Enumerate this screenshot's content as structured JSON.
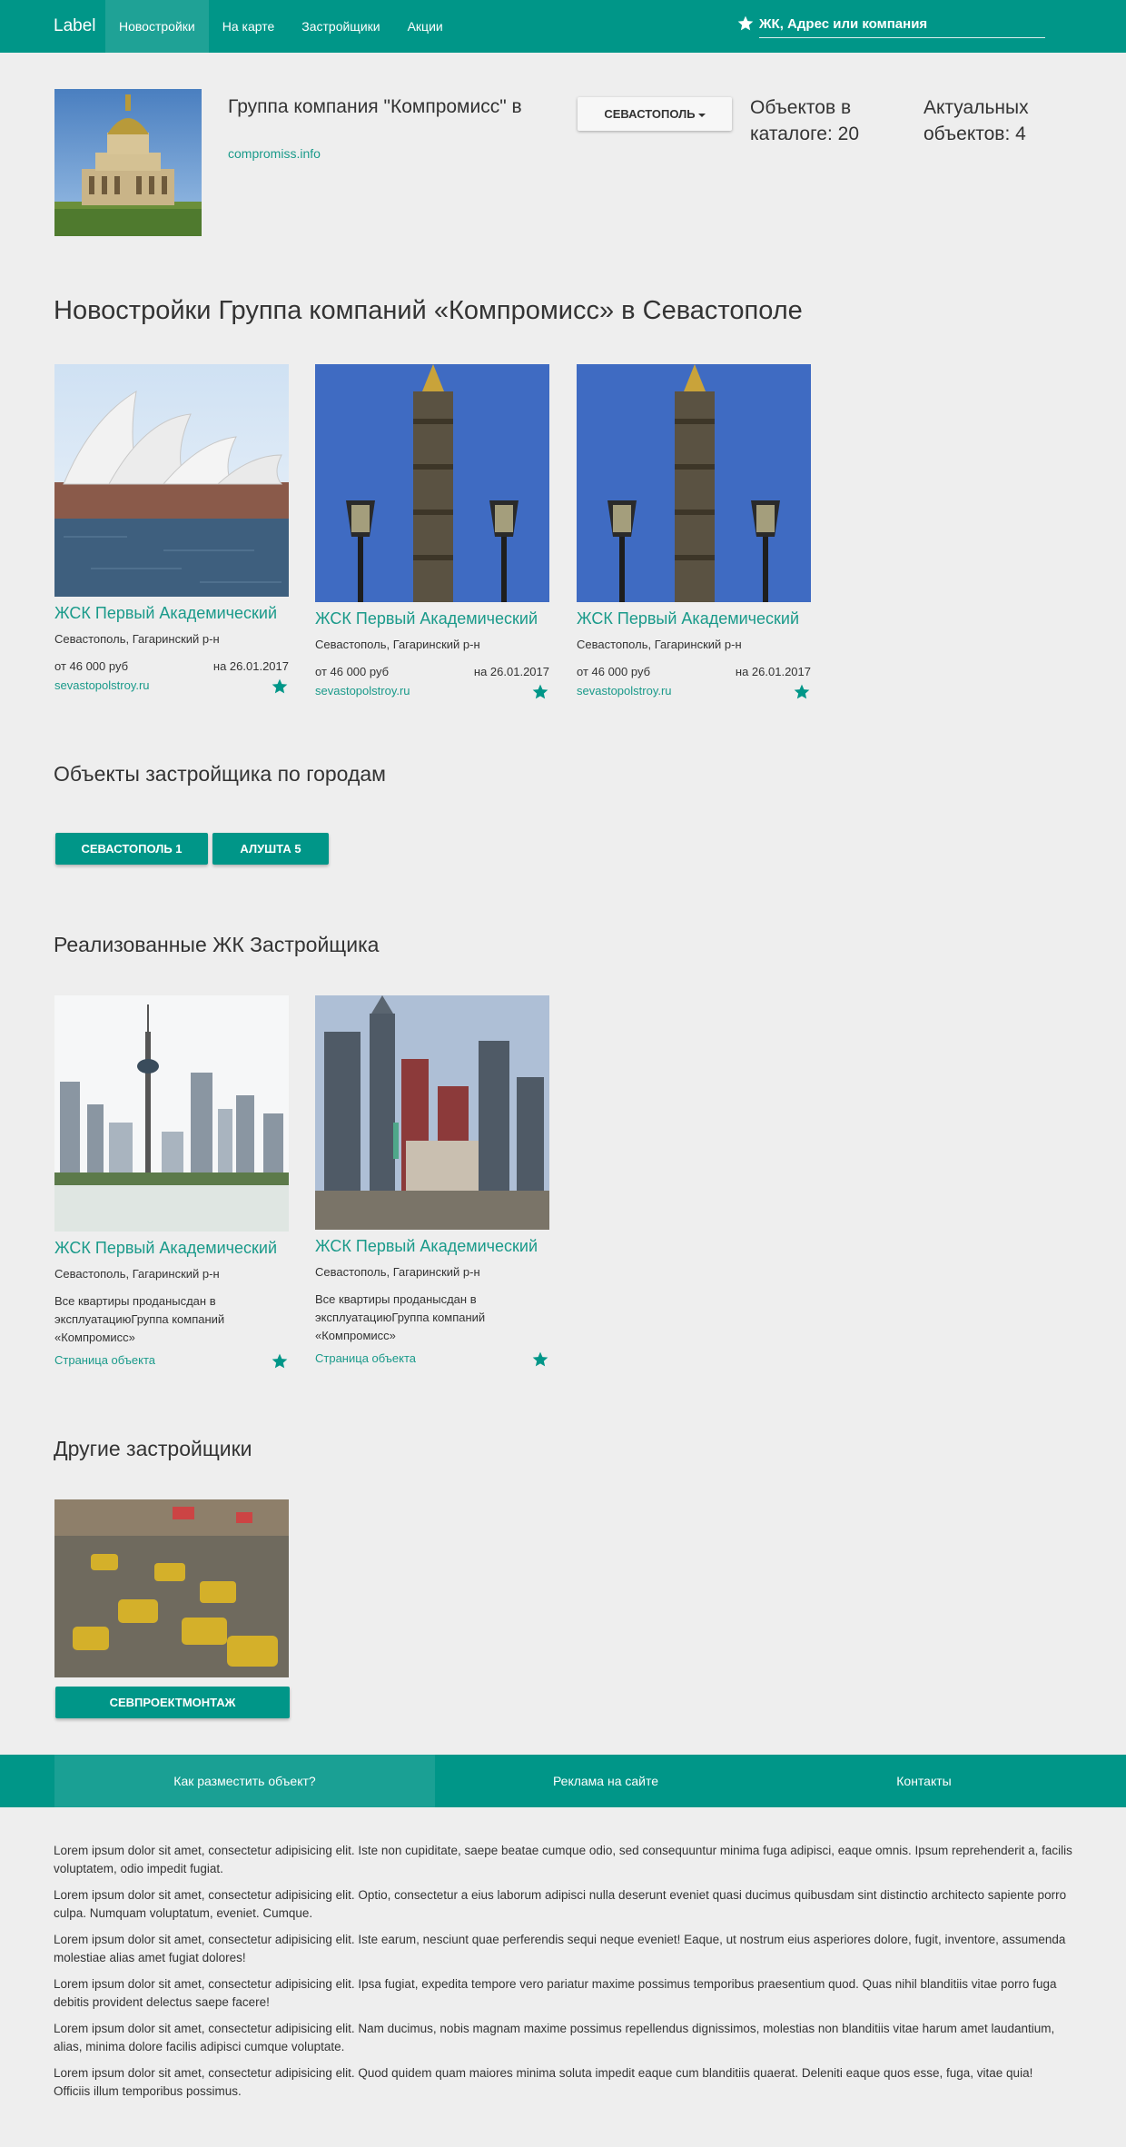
{
  "header": {
    "brand": "Label",
    "nav": [
      "Новостройки",
      "На карте",
      "Застройщики",
      "Акции"
    ],
    "search_placeholder": "ЖК, Адрес или компания"
  },
  "company": {
    "name": "Группа компания \"Компромисс\" в",
    "site": "compromiss.info",
    "city_button": "СЕВАСТОПОЛЬ",
    "stat_catalog": [
      "Объектов в",
      "каталоге: 20"
    ],
    "stat_actual": [
      "Актуальных",
      "объектов: 4"
    ]
  },
  "section_new": {
    "heading": "Новостройки Группа компаний «Компромисс» в Севастополе",
    "cards": [
      {
        "title": "ЖСК Первый Академический",
        "address": "Севастополь, Гагаринский р-н",
        "price": "от 46 000 руб",
        "date": "на 26.01.2017",
        "link": "sevastopolstroy.ru"
      },
      {
        "title": "ЖСК Первый Академический",
        "address": "Севастополь, Гагаринский р-н",
        "price": "от 46 000 руб",
        "date": "на 26.01.2017",
        "link": "sevastopolstroy.ru"
      },
      {
        "title": "ЖСК Первый Академический",
        "address": "Севастополь, Гагаринский р-н",
        "price": "от 46 000 руб",
        "date": "на 26.01.2017",
        "link": "sevastopolstroy.ru"
      }
    ]
  },
  "section_cities": {
    "heading": "Объекты застройщика по городам",
    "buttons": [
      "СЕВАСТОПОЛЬ 1",
      "АЛУШТА 5"
    ]
  },
  "section_done": {
    "heading": "Реализованные ЖК Застройщика",
    "cards": [
      {
        "title": "ЖСК Первый Академический",
        "address": "Севастополь, Гагаринский р-н",
        "description": "Все квартиры проданысдан в эксплуатациюГруппа компаний «Компромисс»",
        "link": "Страница объекта"
      },
      {
        "title": "ЖСК Первый Академический",
        "address": "Севастополь, Гагаринский р-н",
        "description": "Все квартиры проданысдан в эксплуатациюГруппа компаний «Компромисс»",
        "link": "Страница объекта"
      }
    ]
  },
  "section_other": {
    "heading": "Другие застройщики",
    "developer_button": "СЕВПРОЕКТМОНТАЖ"
  },
  "footer_nav": [
    "Как разместить объект?",
    "Реклама на сайте",
    "Контакты"
  ],
  "lorem": [
    "Lorem ipsum dolor sit amet, consectetur adipisicing elit. Iste non cupiditate, saepe beatae cumque odio, sed consequuntur minima fuga adipisci, eaque omnis. Ipsum reprehenderit a, facilis voluptatem, odio impedit fugiat.",
    "Lorem ipsum dolor sit amet, consectetur adipisicing elit. Optio, consectetur a eius laborum adipisci nulla deserunt eveniet quasi ducimus quibusdam sint distinctio architecto sapiente porro culpa. Numquam voluptatum, eveniet. Cumque.",
    "Lorem ipsum dolor sit amet, consectetur adipisicing elit. Iste earum, nesciunt quae perferendis sequi neque eveniet! Eaque, ut nostrum eius asperiores dolore, fugit, inventore, assumenda molestiae alias amet fugiat dolores!",
    "Lorem ipsum dolor sit amet, consectetur adipisicing elit. Ipsa fugiat, expedita tempore vero pariatur maxime possimus temporibus praesentium quod. Quas nihil blanditiis vitae porro fuga debitis provident delectus saepe facere!",
    "Lorem ipsum dolor sit amet, consectetur adipisicing elit. Nam ducimus, nobis magnam maxime possimus repellendus dignissimos, molestias non blanditiis vitae harum amet laudantium, alias, minima dolore facilis adipisci cumque voluptate.",
    "Lorem ipsum dolor sit amet, consectetur adipisicing elit. Quod quidem quam maiores minima soluta impedit eaque cum blanditiis quaerat. Deleniti eaque quos esse, fuga, vitae quia! Officiis illum temporibus possimus."
  ],
  "colors": {
    "accent": "#009688",
    "link": "#1a9a8a",
    "background": "#eeeeee"
  },
  "icons": [
    "star-icon"
  ]
}
